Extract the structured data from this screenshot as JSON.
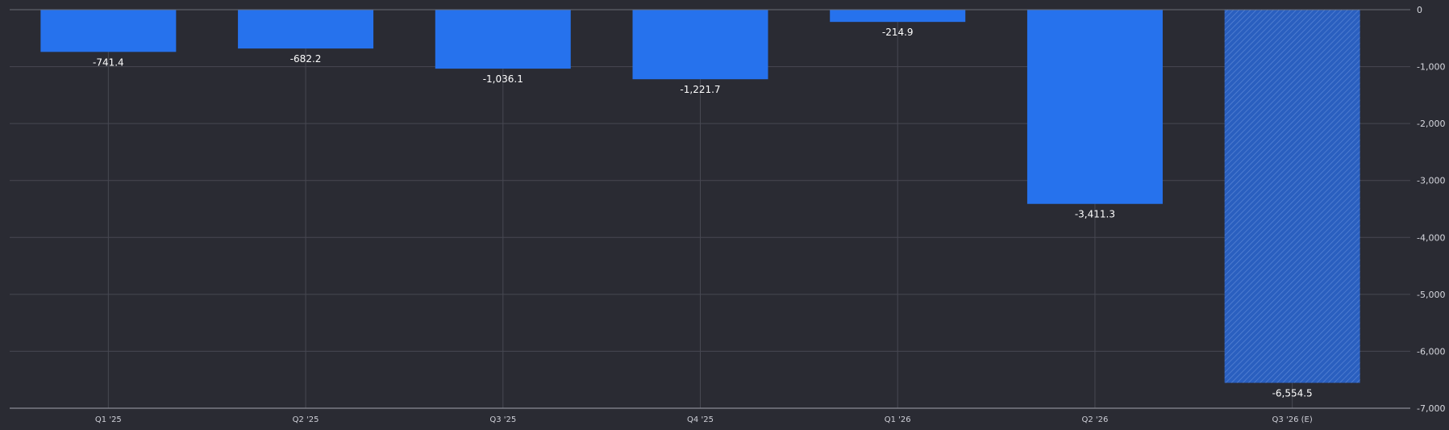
{
  "chart_data": {
    "type": "bar",
    "categories": [
      "Q1 '25",
      "Q2 '25",
      "Q3 '25",
      "Q4 '25",
      "Q1 '26",
      "Q2 '26",
      "Q3 '26 (E)"
    ],
    "values": [
      -741.4,
      -682.2,
      -1036.1,
      -1221.7,
      -214.9,
      -3411.3,
      -6554.5
    ],
    "data_labels": [
      "-741.4",
      "-682.2",
      "-1,036.1",
      "-1,221.7",
      "-214.9",
      "-3,411.3",
      "-6,554.5"
    ],
    "estimated": [
      false,
      false,
      false,
      false,
      false,
      false,
      true
    ],
    "y_ticks": [
      0,
      -1000,
      -2000,
      -3000,
      -4000,
      -5000,
      -6000,
      -7000
    ],
    "y_tick_labels": [
      "0",
      "-1,000",
      "-2,000",
      "-3,000",
      "-4,000",
      "-5,000",
      "-6,000",
      "-7,000"
    ],
    "ylim": [
      -7000,
      0
    ],
    "y_axis_side": "right",
    "grid": true,
    "title": "",
    "xlabel": "",
    "ylabel": "",
    "colors": {
      "background": "#2a2b33",
      "bar": "#2672ed",
      "estimated_bar": "#2a5fbf",
      "grid": "#474852"
    }
  }
}
